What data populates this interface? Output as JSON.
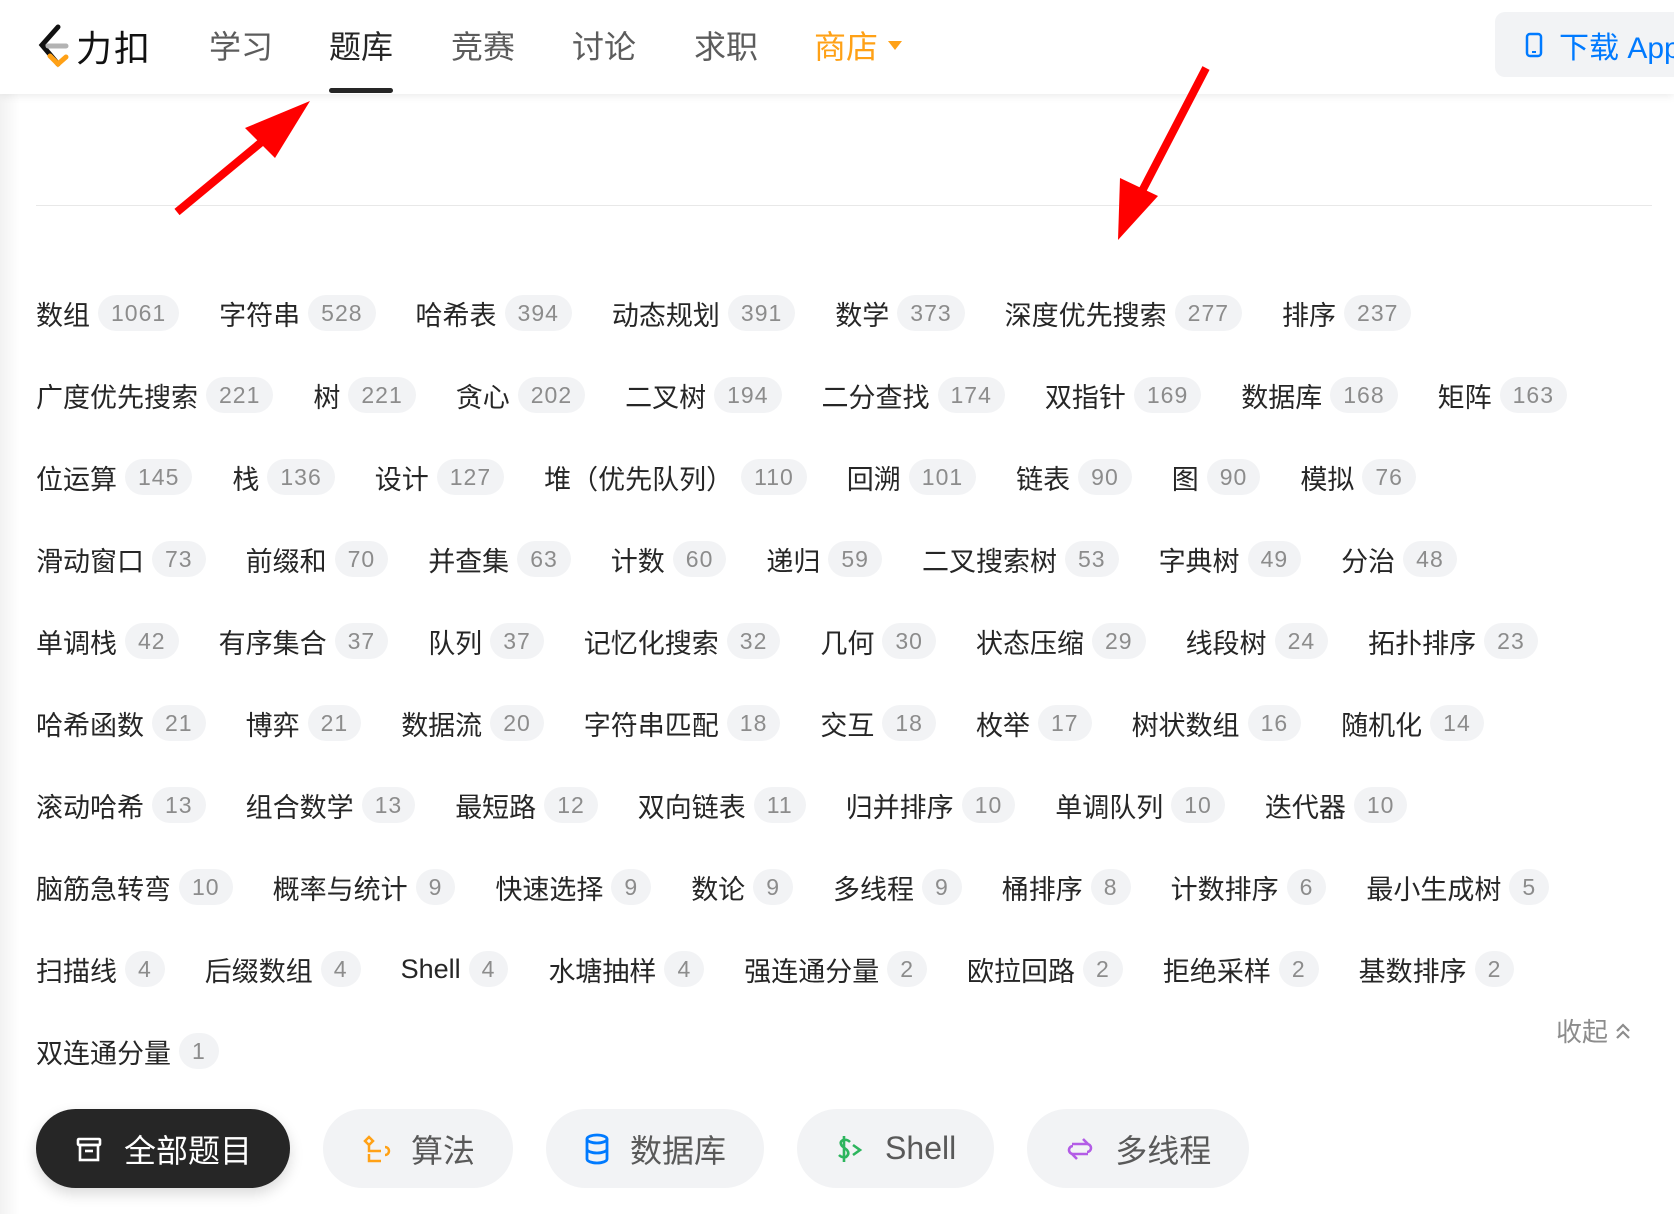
{
  "nav": {
    "logo_text": "力扣",
    "items": [
      "学习",
      "题库",
      "竞赛",
      "讨论",
      "求职"
    ],
    "active": "题库",
    "store": "商店",
    "download": "下载 App"
  },
  "tag_rows": [
    [
      [
        "数组",
        "1061"
      ],
      [
        "字符串",
        "528"
      ],
      [
        "哈希表",
        "394"
      ],
      [
        "动态规划",
        "391"
      ],
      [
        "数学",
        "373"
      ],
      [
        "深度优先搜索",
        "277"
      ],
      [
        "排序",
        "237"
      ]
    ],
    [
      [
        "广度优先搜索",
        "221"
      ],
      [
        "树",
        "221"
      ],
      [
        "贪心",
        "202"
      ],
      [
        "二叉树",
        "194"
      ],
      [
        "二分查找",
        "174"
      ],
      [
        "双指针",
        "169"
      ],
      [
        "数据库",
        "168"
      ],
      [
        "矩阵",
        "163"
      ]
    ],
    [
      [
        "位运算",
        "145"
      ],
      [
        "栈",
        "136"
      ],
      [
        "设计",
        "127"
      ],
      [
        "堆（优先队列）",
        "110"
      ],
      [
        "回溯",
        "101"
      ],
      [
        "链表",
        "90"
      ],
      [
        "图",
        "90"
      ],
      [
        "模拟",
        "76"
      ]
    ],
    [
      [
        "滑动窗口",
        "73"
      ],
      [
        "前缀和",
        "70"
      ],
      [
        "并查集",
        "63"
      ],
      [
        "计数",
        "60"
      ],
      [
        "递归",
        "59"
      ],
      [
        "二叉搜索树",
        "53"
      ],
      [
        "字典树",
        "49"
      ],
      [
        "分治",
        "48"
      ]
    ],
    [
      [
        "单调栈",
        "42"
      ],
      [
        "有序集合",
        "37"
      ],
      [
        "队列",
        "37"
      ],
      [
        "记忆化搜索",
        "32"
      ],
      [
        "几何",
        "30"
      ],
      [
        "状态压缩",
        "29"
      ],
      [
        "线段树",
        "24"
      ],
      [
        "拓扑排序",
        "23"
      ]
    ],
    [
      [
        "哈希函数",
        "21"
      ],
      [
        "博弈",
        "21"
      ],
      [
        "数据流",
        "20"
      ],
      [
        "字符串匹配",
        "18"
      ],
      [
        "交互",
        "18"
      ],
      [
        "枚举",
        "17"
      ],
      [
        "树状数组",
        "16"
      ],
      [
        "随机化",
        "14"
      ]
    ],
    [
      [
        "滚动哈希",
        "13"
      ],
      [
        "组合数学",
        "13"
      ],
      [
        "最短路",
        "12"
      ],
      [
        "双向链表",
        "11"
      ],
      [
        "归并排序",
        "10"
      ],
      [
        "单调队列",
        "10"
      ],
      [
        "迭代器",
        "10"
      ]
    ],
    [
      [
        "脑筋急转弯",
        "10"
      ],
      [
        "概率与统计",
        "9"
      ],
      [
        "快速选择",
        "9"
      ],
      [
        "数论",
        "9"
      ],
      [
        "多线程",
        "9"
      ],
      [
        "桶排序",
        "8"
      ],
      [
        "计数排序",
        "6"
      ],
      [
        "最小生成树",
        "5"
      ]
    ],
    [
      [
        "扫描线",
        "4"
      ],
      [
        "后缀数组",
        "4"
      ],
      [
        "Shell",
        "4"
      ],
      [
        "水塘抽样",
        "4"
      ],
      [
        "强连通分量",
        "2"
      ],
      [
        "欧拉回路",
        "2"
      ],
      [
        "拒绝采样",
        "2"
      ],
      [
        "基数排序",
        "2"
      ]
    ],
    [
      [
        "双连通分量",
        "1"
      ]
    ]
  ],
  "collapse_label": "收起",
  "categories": [
    {
      "label": "全部题目",
      "icon": "box-icon",
      "color": "#ffffff",
      "active": true
    },
    {
      "label": "算法",
      "icon": "flow-icon",
      "color": "#ffa116"
    },
    {
      "label": "数据库",
      "icon": "database-icon",
      "color": "#007aff"
    },
    {
      "label": "Shell",
      "icon": "terminal-icon",
      "color": "#2db55d"
    },
    {
      "label": "多线程",
      "icon": "swap-icon",
      "color": "#b35ce6"
    }
  ],
  "colors": {
    "accent": "#ffa116",
    "link": "#007aff",
    "annotation": "#ff0000"
  }
}
